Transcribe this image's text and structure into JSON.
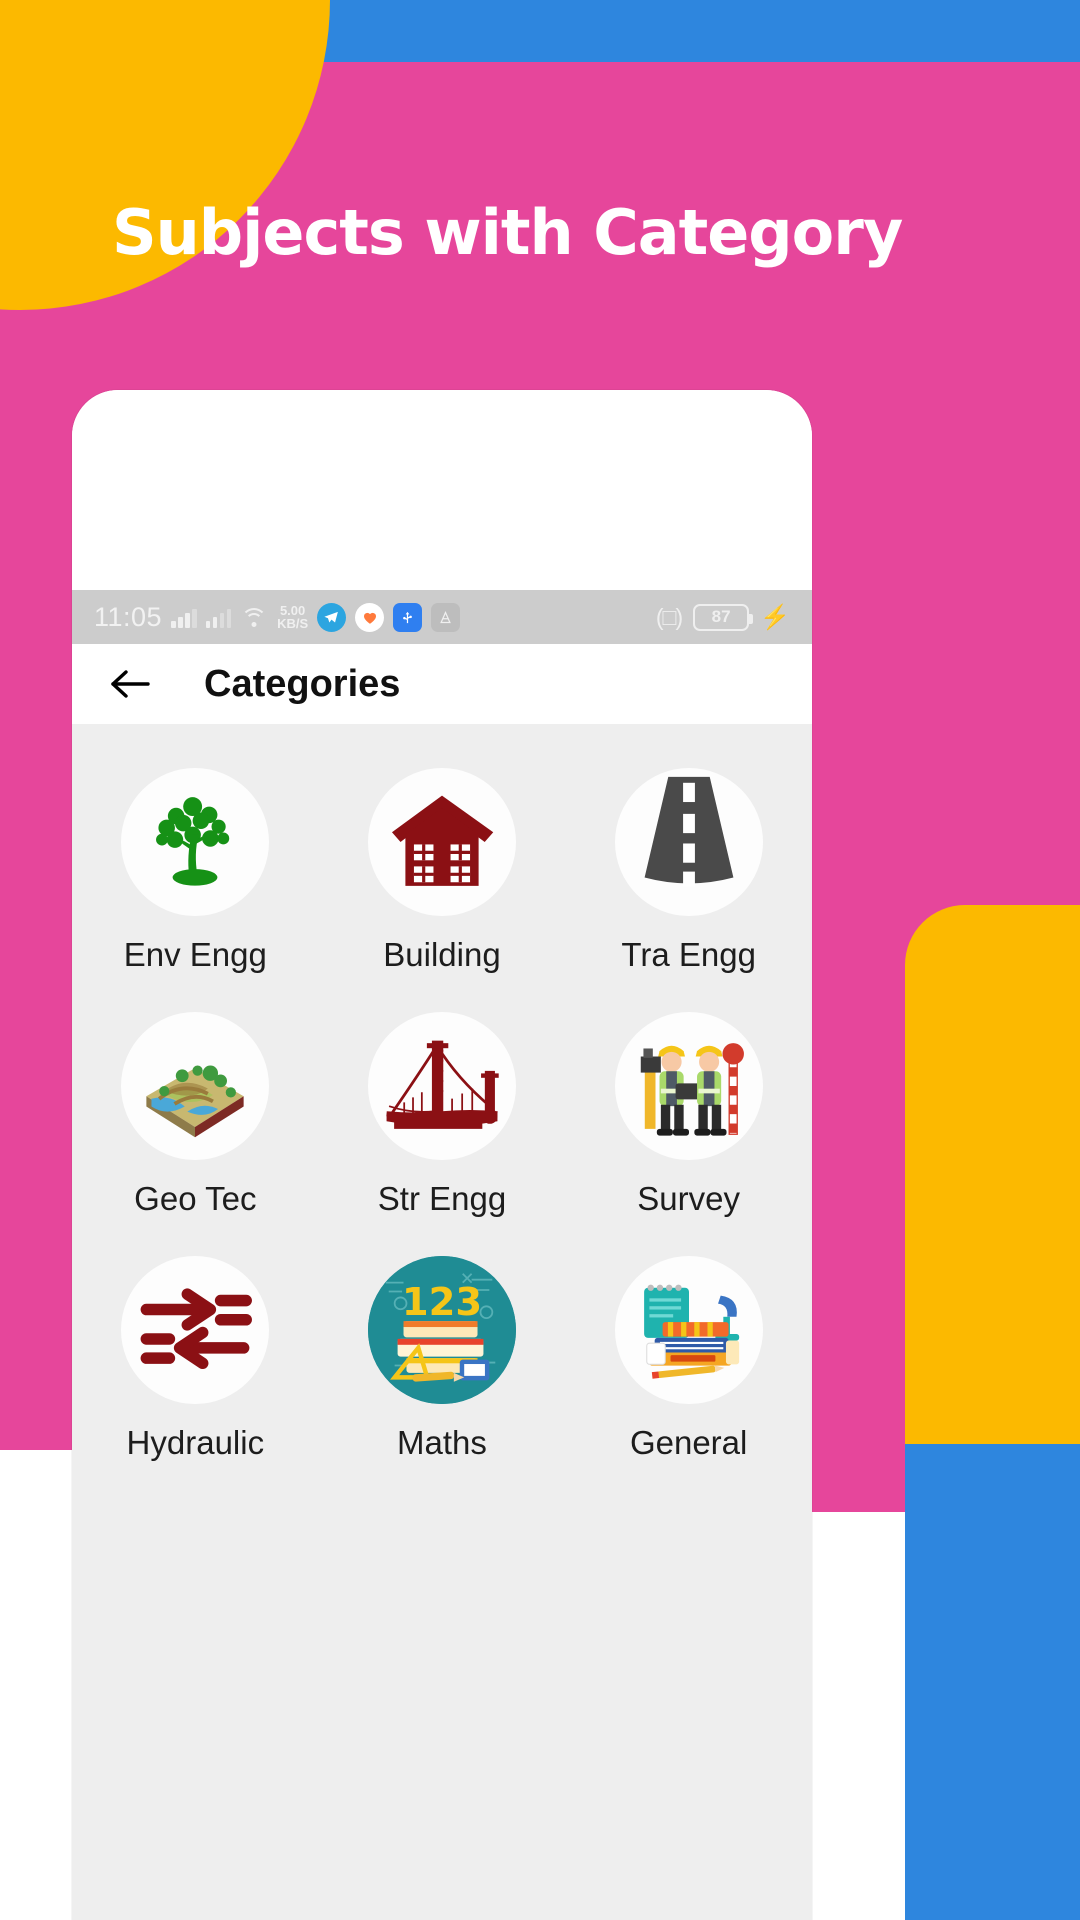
{
  "promo": {
    "headline": "Subjects with Category",
    "colors": {
      "pink": "#e6469b",
      "yellow": "#fcb900",
      "blue": "#2e86de",
      "headline_text": "#ffffff"
    }
  },
  "phone": {
    "statusbar": {
      "time": "11:05",
      "net_speed_value": "5.00",
      "net_speed_unit": "KB/S",
      "signal_icon_1": "signal-bars-icon",
      "signal_icon_2": "signal-bars-icon",
      "wifi_icon": "wifi-icon",
      "app_icons": [
        {
          "name": "telegram-icon",
          "glyph": "➤"
        },
        {
          "name": "heart-app-icon",
          "glyph": "🧡"
        },
        {
          "name": "usb-icon",
          "glyph": "Ψ"
        },
        {
          "name": "adb-icon",
          "glyph": "⏏"
        }
      ],
      "vibrate_icon": "vibrate-icon",
      "battery_level": "87",
      "charging_icon": "charging-bolt-icon"
    },
    "appbar": {
      "back_icon": "back-arrow-icon",
      "title": "Categories"
    },
    "categories": [
      {
        "label": "Env Engg",
        "icon": "tree-icon"
      },
      {
        "label": "Building",
        "icon": "house-icon"
      },
      {
        "label": "Tra Engg",
        "icon": "road-icon"
      },
      {
        "label": "Geo Tec",
        "icon": "terrain-icon"
      },
      {
        "label": "Str Engg",
        "icon": "bridge-icon"
      },
      {
        "label": "Survey",
        "icon": "surveyors-icon"
      },
      {
        "label": "Hydraulic",
        "icon": "flow-arrows-icon"
      },
      {
        "label": "Maths",
        "icon": "numbers-books-icon"
      },
      {
        "label": "General",
        "icon": "books-stack-icon"
      }
    ]
  }
}
